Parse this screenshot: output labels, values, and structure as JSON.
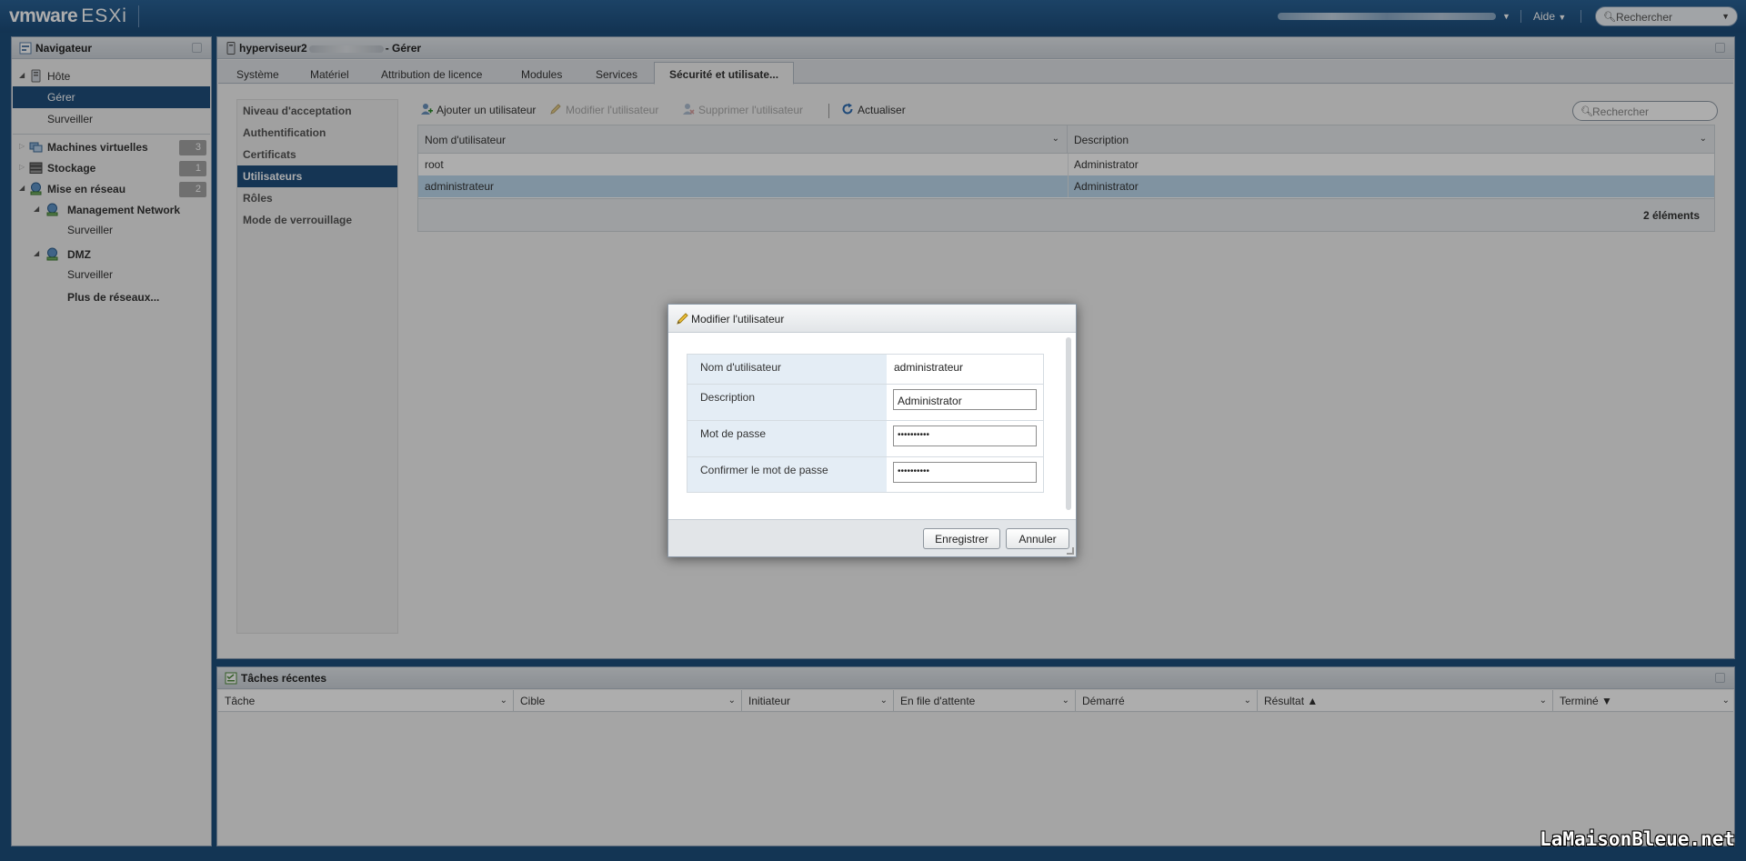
{
  "topbar": {
    "brand_vm": "vmware",
    "brand_product": "ESXi",
    "help_label": "Aide",
    "search_placeholder": "Rechercher"
  },
  "navigator": {
    "title": "Navigateur",
    "items": [
      {
        "label": "Hôte"
      },
      {
        "label": "Gérer"
      },
      {
        "label": "Surveiller"
      },
      {
        "label": "Machines virtuelles",
        "count": "3"
      },
      {
        "label": "Stockage",
        "count": "1"
      },
      {
        "label": "Mise en réseau",
        "count": "2"
      },
      {
        "label": "Management Network"
      },
      {
        "label": "Surveiller"
      },
      {
        "label": "DMZ"
      },
      {
        "label": "Surveiller"
      },
      {
        "label": "Plus de réseaux..."
      }
    ]
  },
  "main": {
    "host_prefix": "hyperviseur2",
    "host_suffix": "- Gérer",
    "tabs": [
      {
        "label": "Système"
      },
      {
        "label": "Matériel"
      },
      {
        "label": "Attribution de licence"
      },
      {
        "label": "Modules"
      },
      {
        "label": "Services"
      },
      {
        "label": "Sécurité et utilisate..."
      }
    ],
    "subnav": [
      {
        "label": "Niveau d'acceptation"
      },
      {
        "label": "Authentification"
      },
      {
        "label": "Certificats"
      },
      {
        "label": "Utilisateurs"
      },
      {
        "label": "Rôles"
      },
      {
        "label": "Mode de verrouillage"
      }
    ],
    "toolbar": {
      "add_user": "Ajouter un utilisateur",
      "edit_user": "Modifier l'utilisateur",
      "delete_user": "Supprimer l'utilisateur",
      "refresh": "Actualiser",
      "search_placeholder": "Rechercher"
    },
    "grid": {
      "columns": [
        "Nom d'utilisateur",
        "Description"
      ],
      "rows": [
        {
          "username": "root",
          "description": "Administrator"
        },
        {
          "username": "administrateur",
          "description": "Administrator"
        }
      ],
      "count_label": "2 éléments"
    }
  },
  "tasks": {
    "title": "Tâches récentes",
    "columns": [
      "Tâche",
      "Cible",
      "Initiateur",
      "En file d'attente",
      "Démarré",
      "Résultat ▲",
      "Terminé ▼"
    ]
  },
  "modal": {
    "title": "Modifier l'utilisateur",
    "fields": {
      "username_label": "Nom d'utilisateur",
      "username_value": "administrateur",
      "description_label": "Description",
      "description_value": "Administrator",
      "password_label": "Mot de passe",
      "password_value": "••••••••••",
      "confirm_label": "Confirmer le mot de passe",
      "confirm_value": "••••••••••"
    },
    "save_label": "Enregistrer",
    "cancel_label": "Annuler"
  },
  "watermark": "LaMaisonBleue.net"
}
